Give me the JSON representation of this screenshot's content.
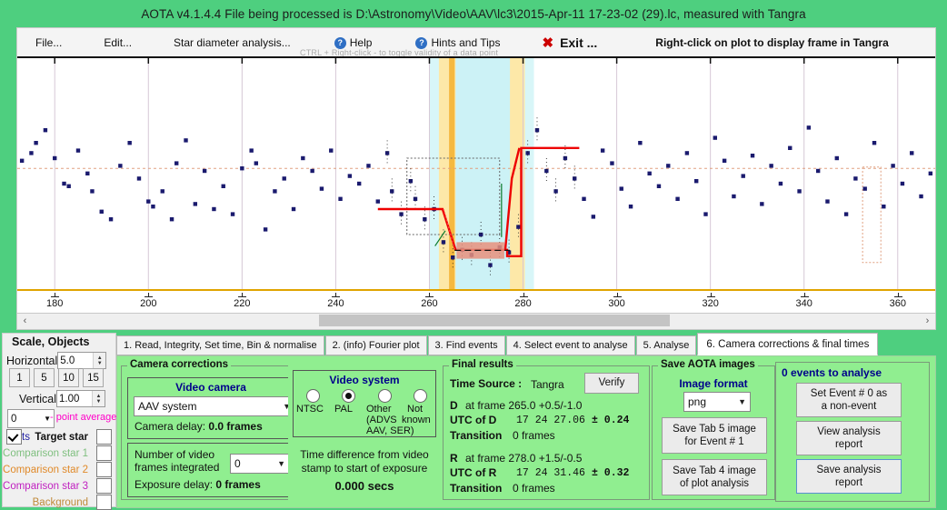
{
  "window": {
    "title": "AOTA v4.1.4.4    File being processed is D:\\Astronomy\\Video\\AAV\\lc3\\2015-Apr-11 17-23-02 (29).lc, measured with Tangra"
  },
  "menu": {
    "file": "File...",
    "edit": "Edit...",
    "star_diameter": "Star diameter analysis...",
    "help": "Help",
    "hints": "Hints and Tips",
    "exit": "Exit ...",
    "exit_mark": "✖",
    "right_click_hint": "Right-click on plot to display frame in Tangra",
    "ctrl_hint": "CTRL + Right-click  -  to toggle validity of a data point"
  },
  "chart_data": {
    "type": "scatter",
    "title": "",
    "xlabel": "",
    "ylabel": "",
    "xlim": [
      172,
      368
    ],
    "ylim": [
      0,
      1
    ],
    "grid": true,
    "tick_values": [
      180,
      200,
      220,
      240,
      260,
      280,
      300,
      320,
      340,
      360
    ],
    "tick_labels": [
      "180",
      "200",
      "220",
      "240",
      "260",
      "280",
      "300",
      "320",
      "340",
      "360"
    ],
    "baseline_level": 0.56,
    "event": {
      "d_frame": 265.0,
      "r_frame": 278.0,
      "d_band": [
        262.8,
        265.6
      ],
      "r_band": [
        277.2,
        279.6
      ],
      "inner_band": [
        265.6,
        277.2
      ],
      "drop_level": 0.24,
      "pre_level": 0.4,
      "post_level": 0.64
    },
    "series": [
      {
        "name": "Target star",
        "color": "#1a1a6e",
        "x": [
          173,
          175,
          176,
          178,
          180,
          182,
          183,
          185,
          187,
          188,
          190,
          192,
          194,
          196,
          198,
          200,
          201,
          203,
          205,
          206,
          208,
          210,
          212,
          214,
          216,
          218,
          220,
          222,
          223,
          225,
          227,
          229,
          231,
          233,
          235,
          237,
          239,
          241,
          243,
          245,
          247,
          249,
          251,
          252,
          254,
          256,
          257,
          259,
          261,
          263,
          265,
          267,
          269,
          271,
          273,
          275,
          277,
          279,
          281,
          283,
          285,
          287,
          289,
          291,
          293,
          295,
          297,
          299,
          301,
          303,
          305,
          307,
          309,
          311,
          313,
          315,
          317,
          319,
          321,
          323,
          325,
          327,
          329,
          331,
          333,
          335,
          337,
          339,
          341,
          343,
          345,
          347,
          349,
          351,
          353,
          355,
          357,
          359,
          361,
          363,
          365,
          367
        ],
        "y": [
          0.59,
          0.62,
          0.66,
          0.71,
          0.6,
          0.5,
          0.49,
          0.63,
          0.54,
          0.47,
          0.39,
          0.36,
          0.57,
          0.66,
          0.52,
          0.43,
          0.41,
          0.47,
          0.36,
          0.58,
          0.67,
          0.42,
          0.55,
          0.4,
          0.49,
          0.38,
          0.56,
          0.63,
          0.58,
          0.32,
          0.47,
          0.52,
          0.4,
          0.6,
          0.55,
          0.48,
          0.63,
          0.44,
          0.53,
          0.5,
          0.57,
          0.43,
          0.62,
          0.47,
          0.38,
          0.51,
          0.44,
          0.36,
          0.4,
          0.27,
          0.21,
          0.24,
          0.22,
          0.3,
          0.18,
          0.25,
          0.23,
          0.33,
          0.62,
          0.71,
          0.55,
          0.47,
          0.6,
          0.52,
          0.44,
          0.37,
          0.63,
          0.58,
          0.48,
          0.41,
          0.66,
          0.54,
          0.49,
          0.57,
          0.44,
          0.62,
          0.51,
          0.38,
          0.68,
          0.59,
          0.45,
          0.53,
          0.61,
          0.42,
          0.57,
          0.5,
          0.64,
          0.47,
          0.72,
          0.55,
          0.43,
          0.6,
          0.38,
          0.52,
          0.48,
          0.66,
          0.41,
          0.57,
          0.5,
          0.62,
          0.45,
          0.54
        ]
      }
    ]
  },
  "tabs": [
    {
      "label": "1.  Read, Integrity, Set time, Bin & normalise",
      "selected": false
    },
    {
      "label": "2. (info)  Fourier plot",
      "selected": false
    },
    {
      "label": "3. Find events",
      "selected": false
    },
    {
      "label": "4. Select event to analyse",
      "selected": false
    },
    {
      "label": "5. Analyse",
      "selected": false
    },
    {
      "label": "6. Camera corrections & final times",
      "selected": true
    }
  ],
  "scale_panel": {
    "title": "Scale,  Objects",
    "horizontal_label": "Horizontal",
    "horizontal_value": "5.0",
    "quick_buttons": [
      "1",
      "5",
      "10",
      "15"
    ],
    "vertical_label": "Vertical",
    "vertical_value": "1.00",
    "average_select": "0",
    "average_label": "- point average",
    "objects": [
      {
        "name": "Target star",
        "color": "#111111",
        "checked": true,
        "prefix": "ts"
      },
      {
        "name": "Comparison star 1",
        "color": "#7fbf7f",
        "checked": false
      },
      {
        "name": "Comparison star 2",
        "color": "#e08a2a",
        "checked": false
      },
      {
        "name": "Comparison star 3",
        "color": "#c020c0",
        "checked": false
      },
      {
        "name": "Background",
        "color": "#c08a3a",
        "checked": false
      }
    ]
  },
  "camera_corrections": {
    "caption": "Camera corrections",
    "video_camera_header": "Video camera",
    "camera_value": "AAV system",
    "camera_delay_label": "Camera delay:",
    "camera_delay_value": "0.0 frames",
    "frames_integrated_label_1": "Number of video",
    "frames_integrated_label_2": "frames integrated",
    "frames_integrated_value": "0",
    "exposure_delay_label": "Exposure delay:",
    "exposure_delay_value": "0 frames"
  },
  "video_system": {
    "header": "Video system",
    "options": [
      {
        "label": "NTSC",
        "selected": false
      },
      {
        "label": "PAL",
        "selected": true
      },
      {
        "label": "Other\n(ADVS\nAAV, SER)",
        "selected": false
      },
      {
        "label": "Not\nknown",
        "selected": false
      }
    ],
    "option_ntsc": "NTSC",
    "option_pal": "PAL",
    "option_other_1": "Other",
    "option_other_2": "(ADVS",
    "option_other_3": "AAV, SER)",
    "option_notknown_1": "Not",
    "option_notknown_2": "known",
    "time_diff_line1": "Time difference from video",
    "time_diff_line2": "stamp to start of exposure",
    "time_diff_value": "0.000 secs"
  },
  "final_results": {
    "caption": "Final results",
    "time_source_label": "Time Source :",
    "time_source_value": "Tangra",
    "verify_button": "Verify",
    "d_label": "D",
    "d_text": "at frame 265.0  +0.5/-1.0",
    "utc_d_label": "UTC of D",
    "utc_d_value": "17 24 27.06",
    "utc_d_pm": "± 0.24",
    "d_transition_label": "Transition",
    "d_transition_value": "0 frames",
    "r_label": "R",
    "r_text": "at frame 278.0  +1.5/-0.5",
    "utc_r_label": "UTC of R",
    "utc_r_value": "17 24 31.46",
    "utc_r_pm": "± 0.32",
    "r_transition_label": "Transition",
    "r_transition_value": "0 frames"
  },
  "save_images": {
    "caption": "Save AOTA images",
    "format_header": "Image format",
    "format_value": "png",
    "save_tab5_line1": "Save Tab 5 image",
    "save_tab5_line2": "for Event # 1",
    "save_tab4_line1": "Save Tab 4 image",
    "save_tab4_line2": "of plot analysis"
  },
  "events_panel": {
    "header": "0  events to analyse",
    "non_event_line1": "Set Event # 0 as",
    "non_event_line2": "a non-event",
    "view_report_line1": "View analysis",
    "view_report_line2": "report",
    "save_report_line1": "Save analysis",
    "save_report_line2": "report"
  },
  "scrollbar": {
    "left_arrow": "‹",
    "right_arrow": "›"
  },
  "colors": {
    "window_green": "#4ecf7f",
    "panel_green": "#90ee90",
    "accent_blue": "#00008b",
    "point_navy": "#1a1a6e",
    "event_red": "#ee0000",
    "axis_orange": "#e0a400",
    "magenta": "#ff00c8"
  }
}
